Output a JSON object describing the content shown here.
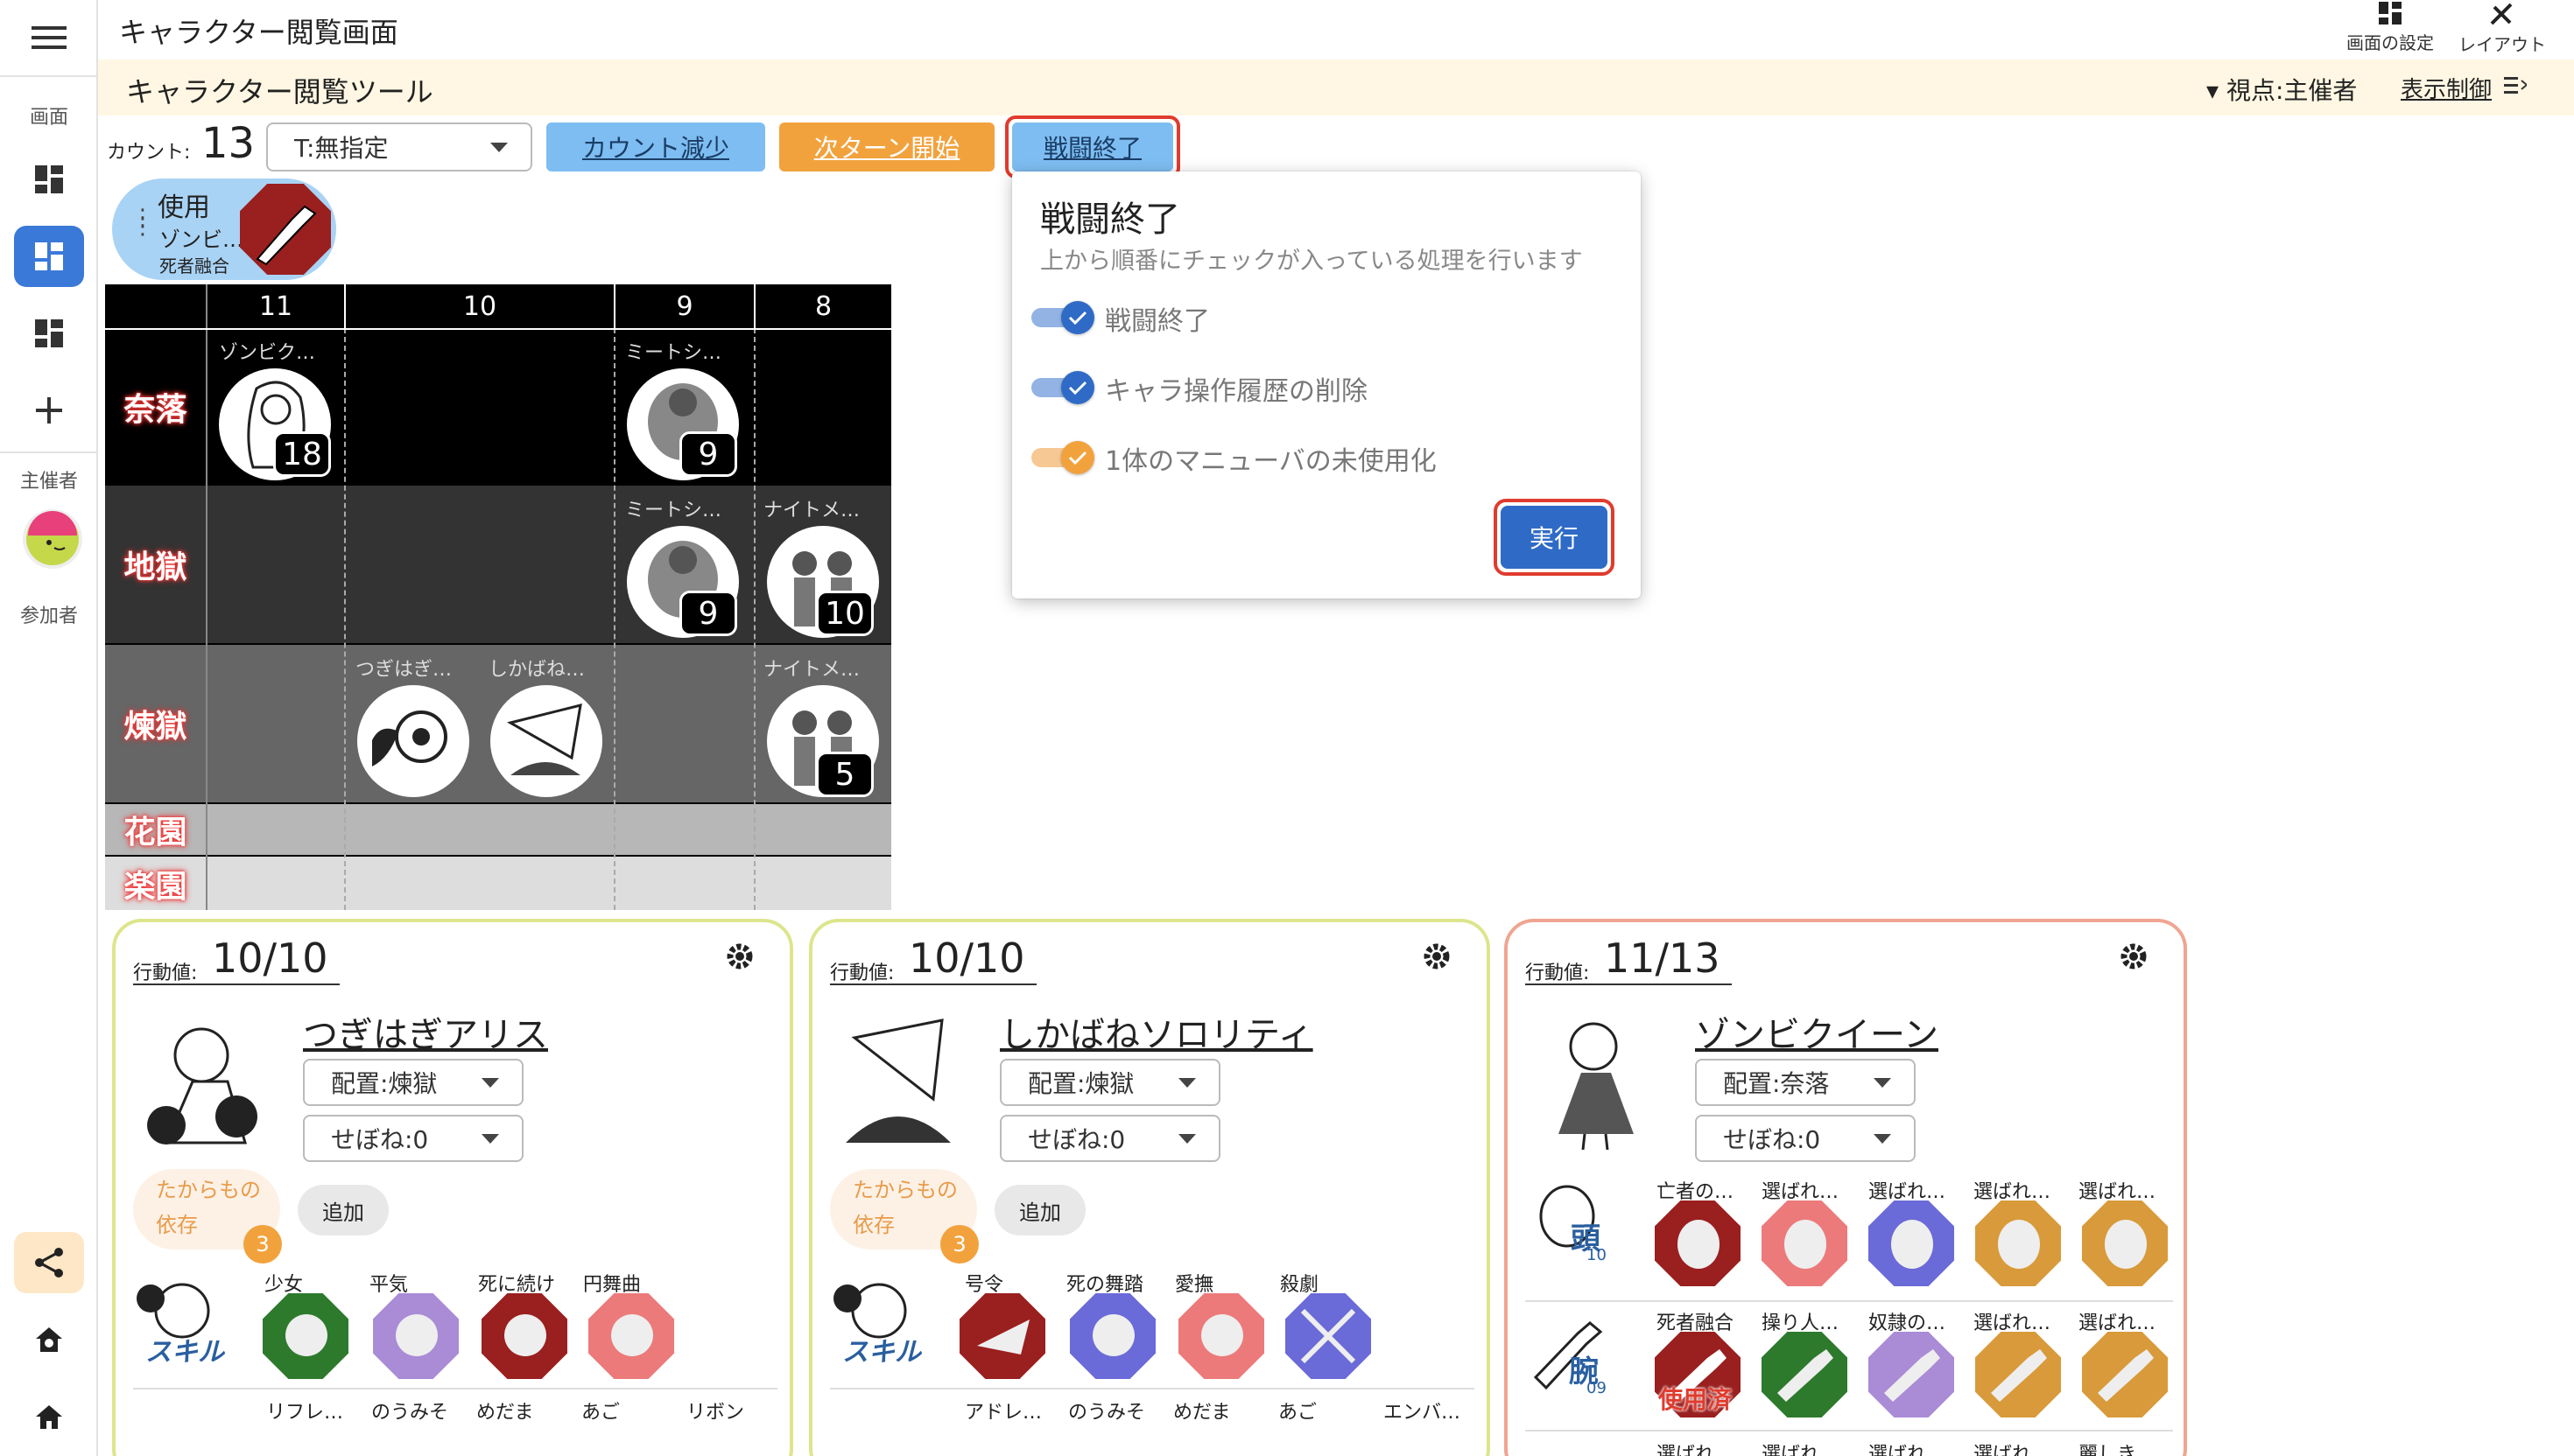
{
  "header": {
    "title": "キャラクター閲覧画面",
    "tool_settings": "画面の設定",
    "tool_layout": "レイアウト"
  },
  "subheader": {
    "title": "キャラクター閲覧ツール",
    "viewpoint": "▾ 視点:主催者",
    "display_control": "表示制御"
  },
  "rail": {
    "screen_label": "画面",
    "host_label": "主催者",
    "participant_label": "参加者"
  },
  "toolbar": {
    "count_label": "カウント:",
    "count_value": "13",
    "timing_select": "T:無指定",
    "btn_decrease": "カウント減少",
    "btn_next_turn": "次ターン開始",
    "btn_end_battle": "戦闘終了"
  },
  "use_chip": {
    "title": "使用",
    "line1": "ゾンビ…",
    "line2": "死者融合"
  },
  "grid": {
    "columns": [
      "11",
      "10",
      "9",
      "8"
    ],
    "rows": [
      "奈落",
      "地獄",
      "煉獄",
      "花園",
      "楽園"
    ],
    "tokens": [
      {
        "name": "ゾンビク…",
        "count": "18"
      },
      {
        "name": "ミートシ…",
        "count": "9"
      },
      {
        "name": "ミートシ…",
        "count": "9"
      },
      {
        "name": "ナイトメ…",
        "count": "10"
      },
      {
        "name": "つぎはぎ…",
        "count": ""
      },
      {
        "name": "しかばね…",
        "count": ""
      },
      {
        "name": "ナイトメ…",
        "count": "5"
      }
    ]
  },
  "dialog": {
    "title": "戦闘終了",
    "description": "上から順番にチェックが入っている処理を行います",
    "options": [
      {
        "label": "戦闘終了",
        "checked": true,
        "color": "#2f6bc6"
      },
      {
        "label": "キャラ操作履歴の削除",
        "checked": true,
        "color": "#2f6bc6"
      },
      {
        "label": "1体のマニューバの未使用化",
        "checked": true,
        "color": "#f2a23d"
      }
    ],
    "execute": "実行"
  },
  "cards": [
    {
      "action_label": "行動値:",
      "action_value": "10/10",
      "name": "つぎはぎアリス",
      "placement": "配置:煉獄",
      "seboneh": "せぼね:0",
      "treasure_line1": "たからもの",
      "treasure_line2": "依存",
      "treasure_count": "3",
      "add": "追加",
      "skill_label": "スキル",
      "row1": [
        "少女",
        "平気",
        "死に続け",
        "円舞曲"
      ],
      "row2": [
        "リフレ…",
        "のうみそ",
        "めだま",
        "あご",
        "リボン"
      ],
      "border": "#dde58c"
    },
    {
      "action_label": "行動値:",
      "action_value": "10/10",
      "name": "しかばねソロリティ",
      "placement": "配置:煉獄",
      "seboneh": "せぼね:0",
      "treasure_line1": "たからもの",
      "treasure_line2": "依存",
      "treasure_count": "3",
      "add": "追加",
      "skill_label": "スキル",
      "row1": [
        "号令",
        "死の舞踏",
        "愛撫",
        "殺劇"
      ],
      "row2": [
        "アドレ…",
        "のうみそ",
        "めだま",
        "あご",
        "エンバ…"
      ],
      "border": "#dde58c"
    },
    {
      "action_label": "行動値:",
      "action_value": "11/13",
      "name": "ゾンビクイーン",
      "placement": "配置:奈落",
      "seboneh": "せぼね:0",
      "head_label": "頭",
      "head_num": "10",
      "arm_label": "腕",
      "arm_num": "09",
      "used_label": "使用済",
      "row1": [
        "亡者の…",
        "選ばれ…",
        "選ばれ…",
        "選ばれ…",
        "選ばれ…"
      ],
      "row2": [
        "死者融合",
        "操り人…",
        "奴隷の…",
        "選ばれ…",
        "選ばれ…"
      ],
      "row3": [
        "選ばれ…",
        "選ばれ…",
        "選ばれ…",
        "選ばれ…",
        "麗しき…"
      ],
      "border": "#f0a591"
    }
  ],
  "colors": {
    "accent_blue": "#2f6bc6",
    "button_blue": "#7ebdf1",
    "button_orange": "#f2a23d",
    "highlight_red": "#e03b2e",
    "row_label_glow": "#e33333"
  }
}
